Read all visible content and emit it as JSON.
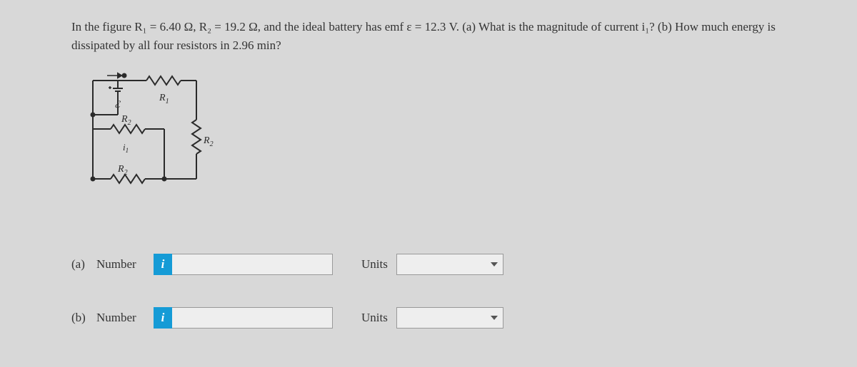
{
  "problem": {
    "text_full": "In the figure R₁ = 6.40 Ω, R₂ = 19.2 Ω, and the ideal battery has emf ε = 12.3 V. (a) What is the magnitude of current i₁? (b) How much energy is dissipated by all four resistors in 2.96 min?"
  },
  "circuit": {
    "emf_label": "ℰ",
    "r1_label": "R₁",
    "r2_label": "R₂",
    "i1_label": "i₁"
  },
  "parts": {
    "a": {
      "label": "(a)",
      "number_label": "Number",
      "units_label": "Units",
      "info": "i"
    },
    "b": {
      "label": "(b)",
      "number_label": "Number",
      "units_label": "Units",
      "info": "i"
    }
  }
}
